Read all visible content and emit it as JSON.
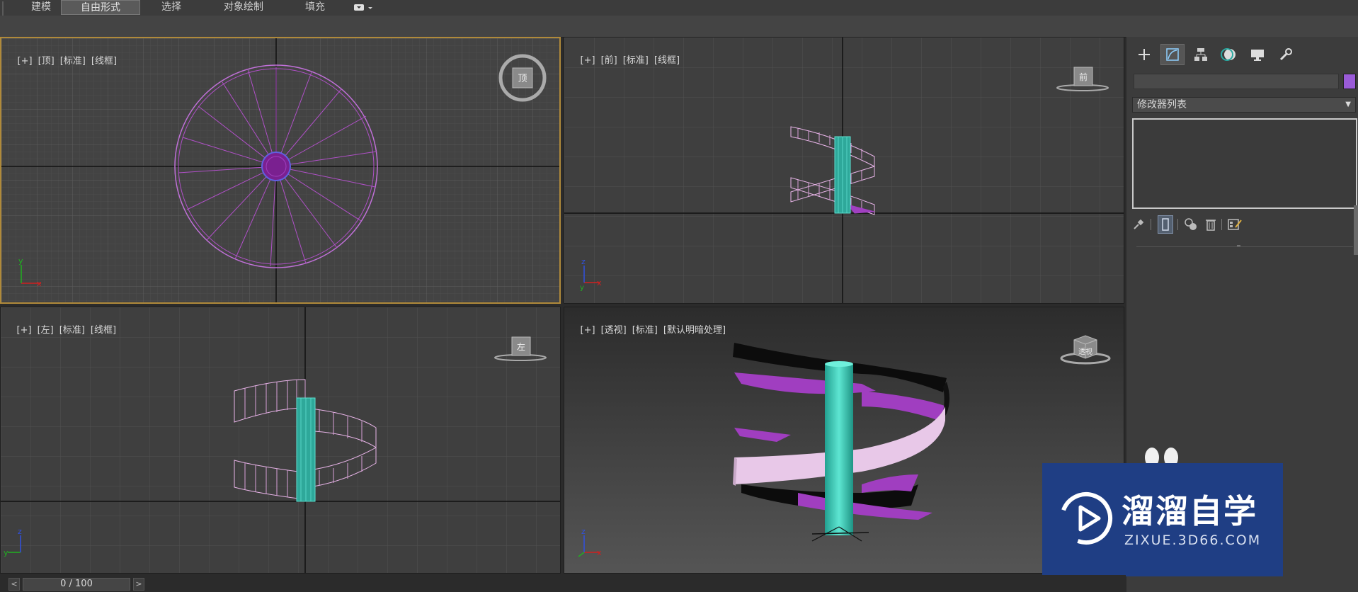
{
  "ribbon": {
    "tabs": [
      {
        "label": "建模"
      },
      {
        "label": "自由形式"
      },
      {
        "label": "选择"
      },
      {
        "label": "对象绘制"
      },
      {
        "label": "填充"
      }
    ],
    "active_tab": "自由形式",
    "more_icon": "ribbon-options-icon"
  },
  "viewports": {
    "top": {
      "labels": [
        "[+]",
        "[顶]",
        "[标准]",
        "[线框]"
      ],
      "viewcube": "顶"
    },
    "front": {
      "labels": [
        "[+]",
        "[前]",
        "[标准]",
        "[线框]"
      ],
      "viewcube": "前"
    },
    "left": {
      "labels": [
        "[+]",
        "[左]",
        "[标准]",
        "[线框]"
      ],
      "viewcube": "左"
    },
    "persp": {
      "labels": [
        "[+]",
        "[透视]",
        "[标准]",
        "[默认明暗处理]"
      ],
      "viewcube": "透视"
    }
  },
  "command_panel": {
    "tabs": [
      "create-icon",
      "modify-icon",
      "hierarchy-icon",
      "motion-icon",
      "display-icon",
      "utilities-icon"
    ],
    "active_tab": "modify-icon",
    "name_value": "",
    "object_color": "#9a5bd8",
    "modifier_list": "修改器列表",
    "stack_tools": [
      "pin-stack-icon",
      "show-end-result-icon",
      "make-unique-icon",
      "remove-modifier-icon",
      "configure-modifier-sets-icon"
    ]
  },
  "timeline": {
    "position": "0 / 100",
    "prev": "<",
    "next": ">"
  },
  "watermark": {
    "text": "溜溜自学",
    "sub": "ZIXUE.3D66.COM"
  },
  "colors": {
    "active_border": "#b08a3a",
    "wire_magenta": "#c257d8",
    "wire_pink": "#e8b4e8",
    "cyan": "#3cc8b4",
    "watermark_bg": "#1f3e84"
  }
}
